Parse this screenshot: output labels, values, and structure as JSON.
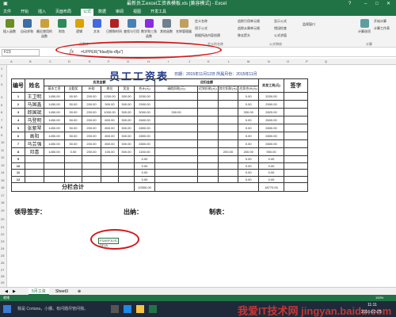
{
  "window": {
    "title": "最新员工excel工资表模板.xls [兼容模式] - Excel",
    "help": "?"
  },
  "ribbon_tabs": [
    "文件",
    "开始",
    "插入",
    "页面布局",
    "公式",
    "数据",
    "审阅",
    "视图",
    "开发工具"
  ],
  "active_tab": "公式",
  "ribbon": {
    "buttons": [
      "插入函数",
      "自动求和",
      "最近使用的函数",
      "财务",
      "逻辑",
      "文本",
      "日期和时间",
      "查找与引用",
      "数学和三角函数",
      "其他函数",
      "名称管理器",
      "计算选项"
    ],
    "small_items": [
      "定义名称",
      "用于公式",
      "根据所选内容创建",
      "追踪引用单元格",
      "追踪从属单元格",
      "移去箭头",
      "显示公式",
      "错误检查",
      "公式求值",
      "监视窗口",
      "开始计算",
      "计算工作表"
    ],
    "groups": [
      "函数库",
      "定义的名称",
      "公式审核",
      "计算"
    ]
  },
  "formula_bar": {
    "name_box": "F23",
    "fx_label": "fx",
    "formula": "=UPPER(\"fdasfjlis-dfja\")"
  },
  "col_headers": [
    "A",
    "B",
    "C",
    "D",
    "E",
    "F",
    "G",
    "H",
    "I",
    "J",
    "K",
    "L",
    "M",
    "N",
    "O",
    "P",
    "Q"
  ],
  "row_headers": [
    "1",
    "2",
    "3",
    "4",
    "5",
    "6",
    "7",
    "8",
    "9",
    "10",
    "11",
    "12",
    "13",
    "14",
    "15",
    "16",
    "17",
    "18",
    "19",
    "20",
    "21",
    "22",
    "23",
    "24",
    "25",
    "26",
    "27",
    "28",
    "29",
    "30"
  ],
  "sheet": {
    "title": "员工工资表",
    "date_text": "日期：2015年11月12日  所属月份：2015年11月",
    "header": {
      "num": "编号",
      "name": "姓名",
      "payable_group": "应发金额",
      "deduct_group": "应扣金额",
      "real": "实发工资(元)",
      "sign": "签字",
      "cols": [
        "基本工资",
        "全勤奖",
        "补助",
        "岗位",
        "奖金",
        "合计(元)",
        "请假扣款(元)",
        "迟到扣款(元)",
        "其它扣款(元)",
        "应扣合计(元)"
      ]
    },
    "rows": [
      {
        "no": "1",
        "name": "王卫明",
        "v": [
          "1450.00",
          "50.00",
          "200.00",
          "1200.00",
          "300.00",
          "3200.00",
          "",
          "",
          "",
          "0.00",
          "3200.00"
        ]
      },
      {
        "no": "2",
        "name": "马国鑫",
        "v": [
          "1450.00",
          "50.00",
          "200.00",
          "900.00",
          "300.00",
          "2900.00",
          "",
          "",
          "",
          "0.00",
          "2900.00"
        ]
      },
      {
        "no": "3",
        "name": "郎国斌",
        "v": [
          "1450.00",
          "50.00",
          "200.00",
          "1000.00",
          "300.00",
          "3000.00",
          "330.00",
          "",
          "",
          "330.00",
          "2820.00"
        ]
      },
      {
        "no": "4",
        "name": "马登明",
        "v": [
          "1450.00",
          "50.00",
          "200.00",
          "600.00",
          "300.00",
          "2600.00",
          "",
          "",
          "",
          "0.00",
          "2600.00"
        ]
      },
      {
        "no": "5",
        "name": "张紫琴",
        "v": [
          "1450.00",
          "50.00",
          "200.00",
          "800.00",
          "300.00",
          "2800.00",
          "",
          "",
          "",
          "0.00",
          "2800.00"
        ]
      },
      {
        "no": "6",
        "name": "高阳",
        "v": [
          "1450.00",
          "50.00",
          "200.00",
          "800.00",
          "300.00",
          "2800.00",
          "",
          "",
          "",
          "0.00",
          "2800.00"
        ]
      },
      {
        "no": "7",
        "name": "马芸强",
        "v": [
          "1450.00",
          "50.00",
          "200.00",
          "800.00",
          "300.00",
          "2800.00",
          "",
          "",
          "",
          "0.00",
          "2800.00"
        ]
      },
      {
        "no": "8",
        "name": "邓喜",
        "v": [
          "1450.00",
          "0.00",
          "200.00",
          "100.00",
          "300.00",
          "1150.00",
          "",
          "",
          "200.00",
          "200.00",
          "950.00"
        ]
      },
      {
        "no": "9",
        "name": "",
        "v": [
          "",
          "",
          "",
          "",
          "",
          "0.00",
          "",
          "",
          "",
          "0.00",
          "0.00"
        ]
      },
      {
        "no": "10",
        "name": "",
        "v": [
          "",
          "",
          "",
          "",
          "",
          "0.00",
          "",
          "",
          "",
          "0.00",
          "0.00"
        ]
      },
      {
        "no": "11",
        "name": "",
        "v": [
          "",
          "",
          "",
          "",
          "",
          "0.00",
          "",
          "",
          "",
          "0.00",
          "0.00"
        ]
      },
      {
        "no": "12",
        "name": "",
        "v": [
          "",
          "",
          "",
          "",
          "",
          "0.00",
          "",
          "",
          "",
          "0.00",
          "0.00"
        ]
      }
    ],
    "total_label": "分栏合计",
    "total_sum": "19300.00",
    "total_real": "18770.00",
    "footer": [
      "领导签字：",
      "出纳：",
      "制表："
    ],
    "selected_cell_value": "FDASFJLIS-DFJA"
  },
  "sheet_tabs": [
    "5月工资",
    "Sheet3"
  ],
  "status": {
    "left": "就绪",
    "zoom": "100%"
  },
  "taskbar": {
    "search": "我是 Cortana，小娜。有问题尽管问我。",
    "time": "11:11",
    "date": "2016-02-25"
  },
  "watermark": "我爱IT技术网 jingyan.baidu.com",
  "colors": {
    "excel_green": "#217346",
    "title_blue": "#1f3a8a",
    "highlight_red": "#d01919"
  }
}
